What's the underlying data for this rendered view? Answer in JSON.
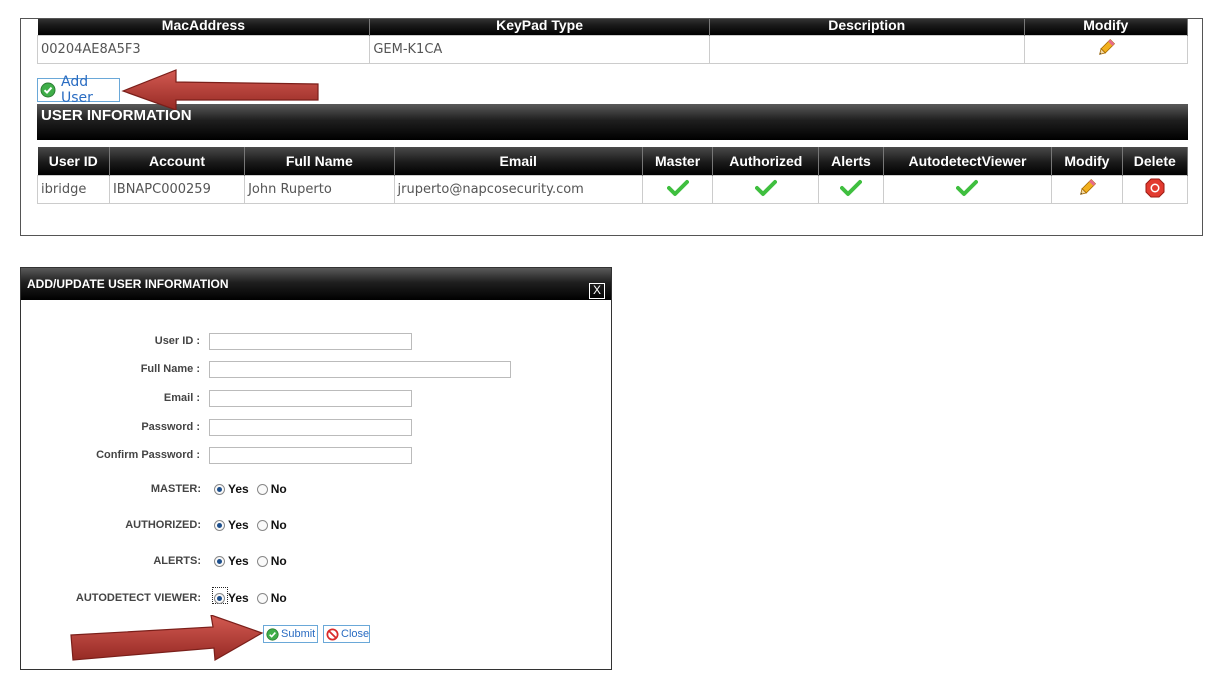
{
  "mac_table": {
    "headers": [
      "MacAddress",
      "KeyPad Type",
      "Description",
      "Modify"
    ],
    "row": {
      "mac": "00204AE8A5F3",
      "keypad": "GEM-K1CA",
      "description": ""
    }
  },
  "add_user_label": "Add User",
  "user_info_title": "USER INFORMATION",
  "user_table": {
    "headers": [
      "User ID",
      "Account",
      "Full Name",
      "Email",
      "Master",
      "Authorized",
      "Alerts",
      "AutodetectViewer",
      "Modify",
      "Delete"
    ],
    "row": {
      "user_id": "ibridge",
      "account": "IBNAPC000259",
      "full_name": "John Ruperto",
      "email": "jruperto@napcosecurity.com"
    }
  },
  "dialog": {
    "title": "ADD/UPDATE USER INFORMATION",
    "close_x": "X",
    "fields": {
      "user_id": "User ID :",
      "full_name": "Full Name :",
      "email": "Email :",
      "password": "Password :",
      "confirm_password": "Confirm Password :"
    },
    "radios": {
      "master": "MASTER:",
      "authorized": "AUTHORIZED:",
      "alerts": "ALERTS:",
      "autodetect": "AUTODETECT VIEWER:"
    },
    "yes": "Yes",
    "no": "No",
    "submit": "Submit",
    "close": "Close"
  },
  "colors": {
    "accent_red": "#b73a33",
    "check_green": "#3fbf3f",
    "link_blue": "#2a6cc2"
  },
  "icons": {
    "modify": "pencil-icon",
    "delete": "stop-icon",
    "check": "checkmark-icon",
    "arrow": "red-arrow-icon"
  }
}
